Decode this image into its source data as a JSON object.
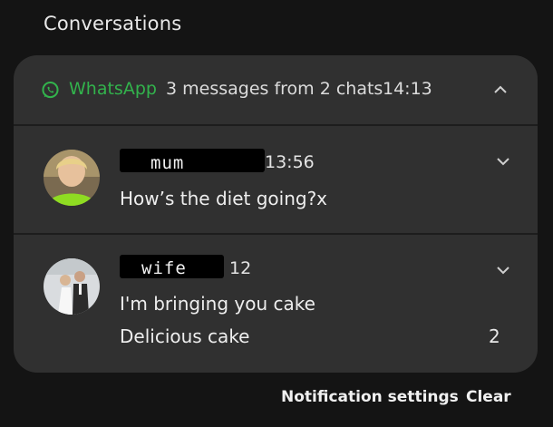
{
  "section": {
    "title": "Conversations"
  },
  "header": {
    "app_name": "WhatsApp",
    "summary": "3 messages from 2 chats",
    "time": "14:13",
    "icon": "whatsapp-icon",
    "brand_color": "#32b34c"
  },
  "conversations": [
    {
      "sender": "mum",
      "time": "13:56",
      "messages": [
        "How’s the diet going?x"
      ],
      "count": ""
    },
    {
      "sender": "wife",
      "time": "12",
      "messages": [
        "I'm bringing you cake",
        "Delicious cake"
      ],
      "count": "2"
    }
  ],
  "footer": {
    "settings_label": "Notification settings",
    "clear_label": "Clear"
  }
}
